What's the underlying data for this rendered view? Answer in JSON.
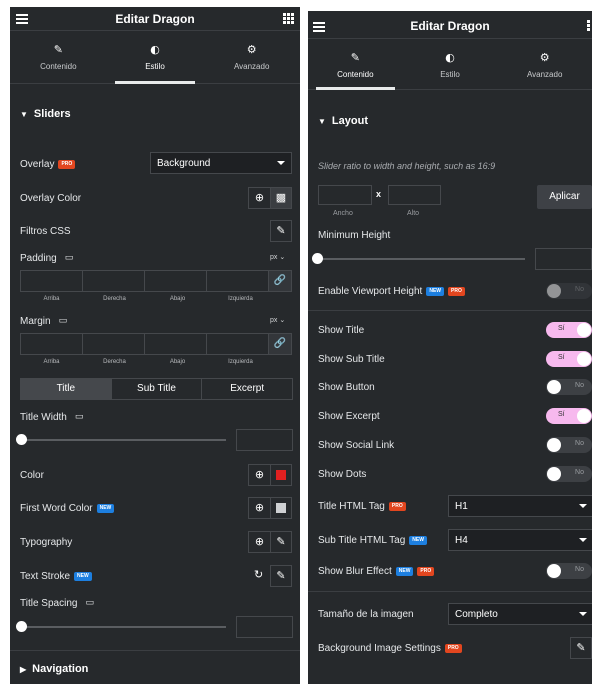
{
  "left": {
    "title": "Editar Dragon",
    "tabs": [
      "Contenido",
      "Estilo",
      "Avanzado"
    ],
    "section": "Sliders",
    "overlay_label": "Overlay",
    "overlay_value": "Background",
    "overlay_color_label": "Overlay Color",
    "filtros_label": "Filtros CSS",
    "padding_label": "Padding",
    "margin_label": "Margin",
    "unit": "px",
    "dim_labels": [
      "Arriba",
      "Derecha",
      "Abajo",
      "Izquierda"
    ],
    "seg_tabs": [
      "Title",
      "Sub Title",
      "Excerpt"
    ],
    "title_width_label": "Title Width",
    "color_label": "Color",
    "first_word_color_label": "First Word Color",
    "typography_label": "Typography",
    "text_stroke_label": "Text Stroke",
    "title_spacing_label": "Title Spacing",
    "navigation_label": "Navigation",
    "color_swatch": "#e02020",
    "first_word_swatch": "#cfd1d3"
  },
  "right": {
    "title": "Editar Dragon",
    "tabs": [
      "Contenido",
      "Estilo",
      "Avanzado"
    ],
    "section": "Layout",
    "hint": "Slider ratio to width and height, such as 16:9",
    "x_label": "x",
    "ancho": "Ancho",
    "alto": "Alto",
    "apply": "Aplicar",
    "min_height": "Minimum Height",
    "viewport_label": "Enable Viewport Height",
    "toggles": [
      {
        "label": "Show Title",
        "state": "Sí"
      },
      {
        "label": "Show Sub Title",
        "state": "Sí"
      },
      {
        "label": "Show Button",
        "state": "No"
      },
      {
        "label": "Show Excerpt",
        "state": "Sí"
      },
      {
        "label": "Show Social Link",
        "state": "No"
      },
      {
        "label": "Show Dots",
        "state": "No"
      }
    ],
    "viewport_state": "No",
    "title_tag_label": "Title HTML Tag",
    "title_tag_value": "H1",
    "subtitle_tag_label": "Sub Title HTML Tag",
    "subtitle_tag_value": "H4",
    "blur_label": "Show Blur Effect",
    "blur_state": "No",
    "img_size_label": "Tamaño de la imagen",
    "img_size_value": "Completo",
    "bg_settings_label": "Background Image Settings"
  },
  "badges": {
    "pro": "PRO",
    "new": "NEW"
  }
}
